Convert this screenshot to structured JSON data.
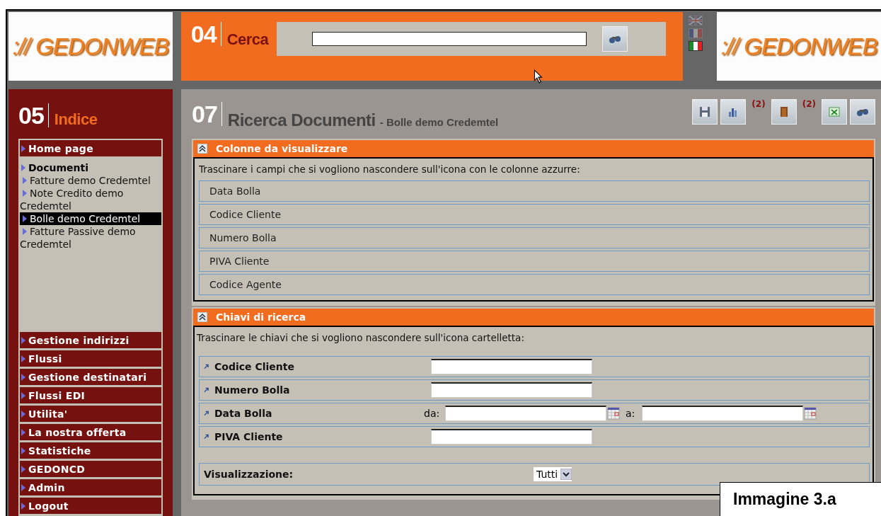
{
  "header": {
    "logo_left": ":// GEDONWEB",
    "search": {
      "number": "04",
      "title": "Cerca"
    },
    "languages": [
      {
        "kind": "uk",
        "selected": false
      },
      {
        "kind": "fr",
        "selected": false
      },
      {
        "kind": "it",
        "selected": true
      }
    ],
    "logo_right": ":// GEDONWEB"
  },
  "sidebar": {
    "number": "05",
    "title": "Indice",
    "items": [
      {
        "label": "Home page",
        "kind": "bar"
      },
      {
        "label": "Documenti",
        "kind": "tree",
        "children": [
          {
            "label": "Fatture demo Credemtel",
            "selected": false
          },
          {
            "label": "Note Credito demo Credemtel",
            "selected": false
          },
          {
            "label": "Bolle demo Credemtel",
            "selected": true
          },
          {
            "label": "Fatture Passive demo Credemtel",
            "selected": false
          }
        ]
      }
    ],
    "menu": [
      "Gestione indirizzi",
      "Flussi",
      "Gestione destinatari",
      "Flussi EDI",
      "Utilita'",
      "La nostra offerta",
      "Statistiche",
      "GEDONCD",
      "Admin",
      "Logout"
    ]
  },
  "content": {
    "number": "07",
    "title": "Ricerca Documenti",
    "subtitle": "- Bolle demo Credemtel",
    "toolbar": [
      {
        "kind": "save"
      },
      {
        "kind": "chart"
      },
      {
        "kind": "folder",
        "badge": "(2)"
      },
      {
        "kind": "excel",
        "badge": "(2)"
      },
      {
        "kind": "search"
      }
    ],
    "columns_section": {
      "title": "Colonne da visualizzare",
      "instructions": "Trascinare i campi che si vogliono nascondere sull'icona con le colonne azzurre:",
      "columns": [
        "Data Bolla",
        "Codice Cliente",
        "Numero Bolla",
        "PIVA Cliente",
        "Codice Agente"
      ]
    },
    "keys_section": {
      "title": "Chiavi di ricerca",
      "instructions": "Trascinare le chiavi che si vogliono nascondere sull'icona cartelletta:",
      "keys": [
        {
          "label": "Codice Cliente",
          "kind": "text"
        },
        {
          "label": "Numero Bolla",
          "kind": "text"
        },
        {
          "label": "Data Bolla",
          "kind": "range",
          "from_label": "da:",
          "to_label": "a:"
        },
        {
          "label": "PIVA Cliente",
          "kind": "text"
        }
      ],
      "display": {
        "label": "Visualizzazione:",
        "value": "Tutti"
      }
    }
  },
  "caption": "Immagine 3.a"
}
